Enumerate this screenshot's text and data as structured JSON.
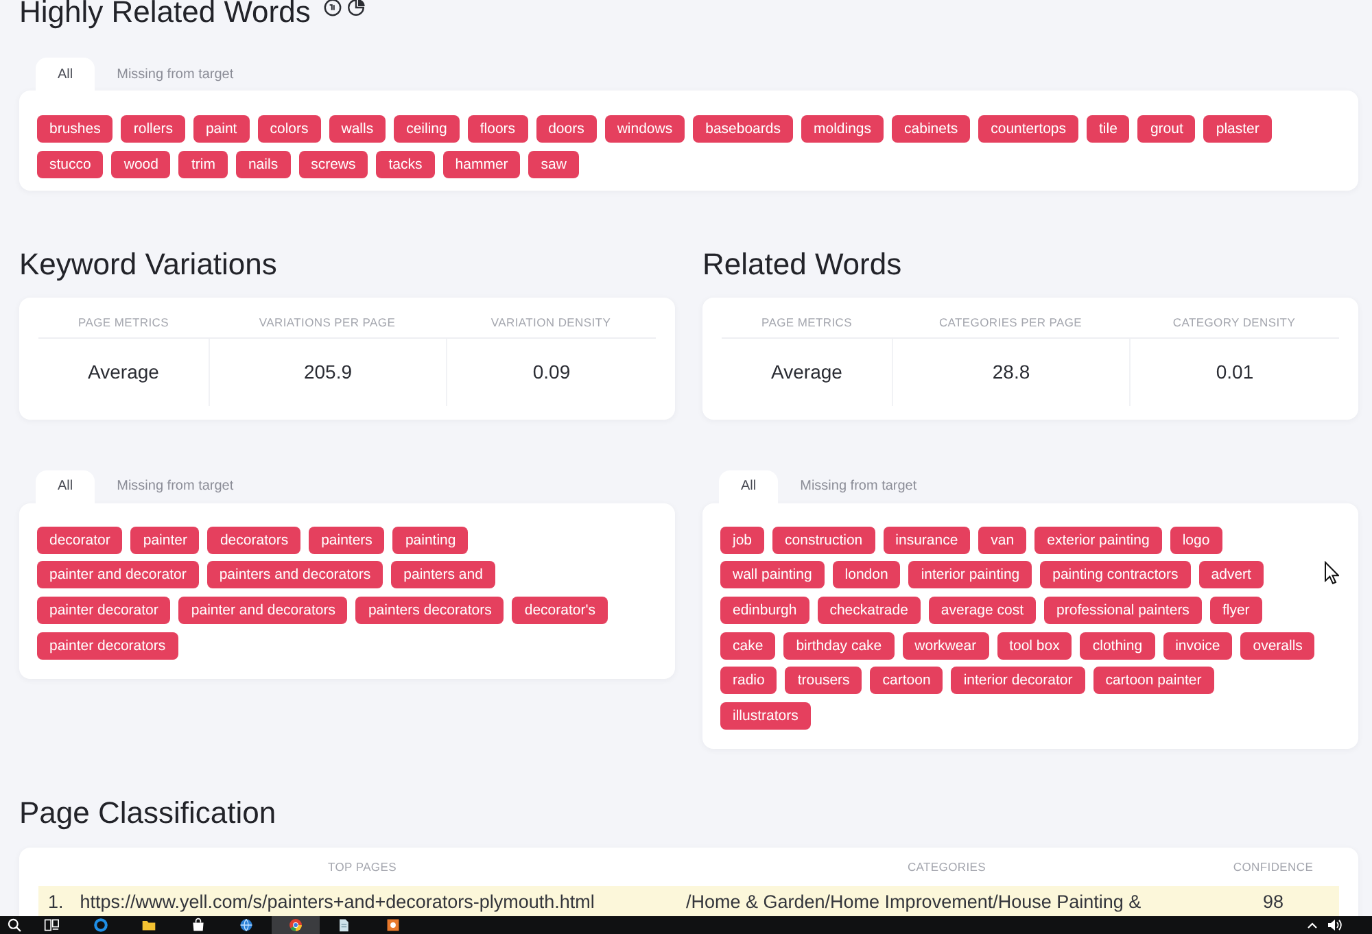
{
  "highly_related_words": {
    "title": "Highly Related Words",
    "tabs": [
      {
        "label": "All",
        "selected": true
      },
      {
        "label": "Missing from target",
        "selected": false
      }
    ],
    "tag_rows": [
      [
        "brushes",
        "rollers",
        "paint",
        "colors",
        "walls",
        "ceiling",
        "floors",
        "doors",
        "windows",
        "baseboards",
        "moldings",
        "cabinets",
        "countertops",
        "tile",
        "grout",
        "plaster"
      ],
      [
        "stucco",
        "wood",
        "trim",
        "nails",
        "screws",
        "tacks",
        "hammer",
        "saw"
      ]
    ]
  },
  "keyword_variations": {
    "title": "Keyword Variations",
    "metrics": {
      "columns": [
        "PAGE METRICS",
        "VARIATIONS PER PAGE",
        "VARIATION DENSITY"
      ],
      "rows": [
        [
          "Average",
          "205.9",
          "0.09"
        ]
      ]
    },
    "tabs": [
      {
        "label": "All",
        "selected": true
      },
      {
        "label": "Missing from target",
        "selected": false
      }
    ],
    "tag_rows": [
      [
        "decorator",
        "painter",
        "decorators",
        "painters",
        "painting"
      ],
      [
        "painter and decorator",
        "painters and decorators",
        "painters and"
      ],
      [
        "painter decorator",
        "painter and decorators",
        "painters decorators",
        "decorator's"
      ],
      [
        "painter decorators"
      ]
    ]
  },
  "related_words": {
    "title": "Related Words",
    "metrics": {
      "columns": [
        "PAGE METRICS",
        "CATEGORIES PER PAGE",
        "CATEGORY DENSITY"
      ],
      "rows": [
        [
          "Average",
          "28.8",
          "0.01"
        ]
      ]
    },
    "tabs": [
      {
        "label": "All",
        "selected": true
      },
      {
        "label": "Missing from target",
        "selected": false
      }
    ],
    "tag_rows": [
      [
        "job",
        "construction",
        "insurance",
        "van",
        "exterior painting",
        "logo"
      ],
      [
        "wall painting",
        "london",
        "interior painting",
        "painting contractors",
        "advert"
      ],
      [
        "edinburgh",
        "checkatrade",
        "average cost",
        "professional painters",
        "flyer"
      ],
      [
        "cake",
        "birthday cake",
        "workwear",
        "tool box",
        "clothing",
        "invoice",
        "overalls"
      ],
      [
        "radio",
        "trousers",
        "cartoon",
        "interior decorator",
        "cartoon painter"
      ],
      [
        "illustrators"
      ]
    ]
  },
  "page_classification": {
    "title": "Page Classification",
    "columns": [
      "TOP PAGES",
      "CATEGORIES",
      "CONFIDENCE"
    ],
    "rows": [
      {
        "rank": "1.",
        "url": "https://www.yell.com/s/painters+and+decorators-plymouth.html",
        "categories": "/Home & Garden/Home Improvement/House Painting &",
        "confidence": "98",
        "highlighted": true
      }
    ]
  },
  "taskbar": {
    "buttons": [
      {
        "active": false
      },
      {
        "active": false
      },
      {
        "active": false
      },
      {
        "active": false
      },
      {
        "active": false
      },
      {
        "active": false
      },
      {
        "active": true
      },
      {
        "active": false
      },
      {
        "active": false
      }
    ]
  }
}
